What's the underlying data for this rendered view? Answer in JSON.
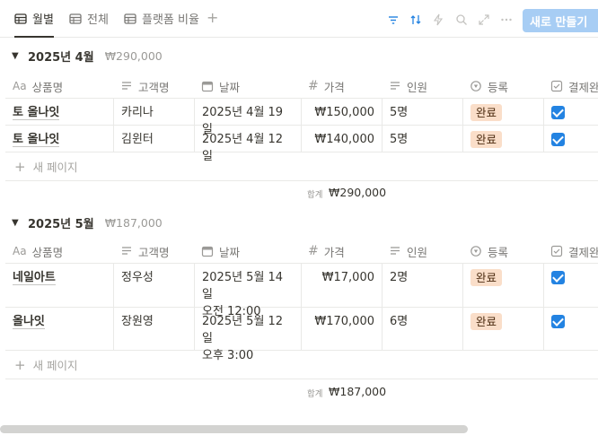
{
  "tabs": [
    {
      "label": "월별",
      "icon": "table-icon",
      "active": true
    },
    {
      "label": "전체",
      "icon": "table-icon",
      "active": false
    },
    {
      "label": "플랫폼 비율",
      "icon": "table-icon",
      "active": false
    }
  ],
  "toolbar": {
    "new_button_label": "새로 만들기",
    "icons": [
      "filter-icon",
      "sort-icon",
      "lightning-icon",
      "search-icon",
      "expand-icon",
      "more-icon"
    ],
    "accent": "#a7cdf4"
  },
  "columns": [
    {
      "label": "상품명",
      "icon": "Aa"
    },
    {
      "label": "고객명",
      "icon": "text-lines-icon"
    },
    {
      "label": "날짜",
      "icon": "calendar-icon"
    },
    {
      "label": "가격",
      "icon": "#"
    },
    {
      "label": "인원",
      "icon": "text-lines-icon"
    },
    {
      "label": "등록",
      "icon": "status-icon"
    },
    {
      "label": "결제완",
      "icon": "checkbox-icon"
    }
  ],
  "groups": [
    {
      "title": "2025년 4월",
      "sum": "₩290,000",
      "rows": [
        {
          "product": "토 올나잇",
          "customer": "카리나",
          "date": "2025년 4월 19일",
          "price": "₩150,000",
          "people": "5명",
          "status": "완료",
          "paid": true
        },
        {
          "product": "토 올나잇",
          "customer": "김윈터",
          "date": "2025년 4월 12일",
          "price": "₩140,000",
          "people": "5명",
          "status": "완료",
          "paid": true
        }
      ],
      "new_page_label": "새 페이지",
      "calc_label": "합계",
      "calc_value": "₩290,000"
    },
    {
      "title": "2025년 5월",
      "sum": "₩187,000",
      "rows": [
        {
          "product": "네일아트",
          "customer": "정우성",
          "date": "2025년 5월 14일",
          "date2": "오전 12:00",
          "price": "₩17,000",
          "people": "2명",
          "status": "완료",
          "paid": true
        },
        {
          "product": "올나잇",
          "customer": "장원영",
          "date": "2025년 5월 12일",
          "date2": "오후 3:00",
          "price": "₩170,000",
          "people": "6명",
          "status": "완료",
          "paid": true
        }
      ],
      "new_page_label": "새 페이지",
      "calc_label": "합계",
      "calc_value": "₩187,000"
    }
  ],
  "colors": {
    "status_badge_bg": "#fadec9",
    "checkbox": "#2383e2"
  }
}
